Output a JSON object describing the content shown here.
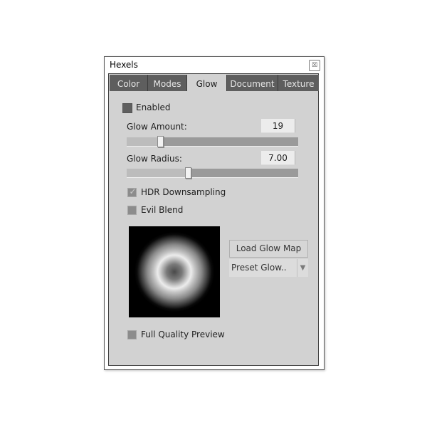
{
  "window": {
    "title": "Hexels",
    "close_icon": "close-icon"
  },
  "tabs": [
    {
      "label": "Color",
      "active": false
    },
    {
      "label": "Modes",
      "active": false
    },
    {
      "label": "Glow",
      "active": true
    },
    {
      "label": "Document",
      "active": false
    },
    {
      "label": "Texture",
      "active": false
    }
  ],
  "glow": {
    "enabled": {
      "label": "Enabled",
      "checked": false
    },
    "amount": {
      "label": "Glow Amount:",
      "value": "19",
      "slider_fraction": 0.2
    },
    "radius": {
      "label": "Glow Radius:",
      "value": "7.00",
      "slider_fraction": 0.36
    },
    "hdr_downsampling": {
      "label": "HDR Downsampling",
      "checked": true,
      "check_glyph": "✓"
    },
    "evil_blend": {
      "label": "Evil Blend",
      "checked": false
    },
    "load_glow_map": "Load Glow Map",
    "preset_select": {
      "value": "Preset Glow..",
      "arrow": "▼"
    },
    "full_quality_preview": {
      "label": "Full Quality Preview",
      "checked": false
    }
  }
}
